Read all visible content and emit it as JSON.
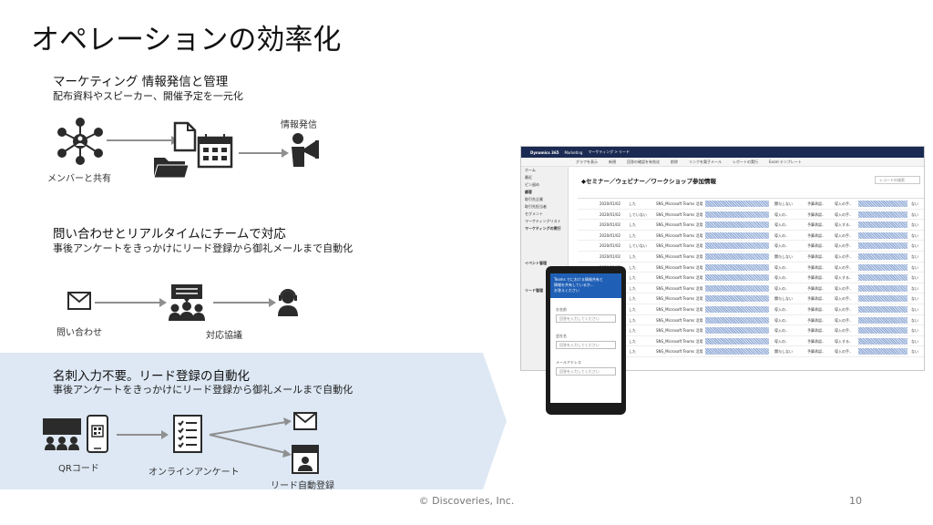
{
  "slide": {
    "title": "オペレーションの効率化",
    "footer": "© Discoveries, Inc.",
    "page_number": "10"
  },
  "sections": [
    {
      "heading": "マーケティング 情報発信と管理",
      "subheading": "配布資料やスピーカー、開催予定を一元化",
      "labels": {
        "share": "メンバーと共有",
        "publish": "情報発信"
      }
    },
    {
      "heading": "問い合わせとリアルタイムにチームで対応",
      "subheading": "事後アンケートをきっかけにリード登録から御礼メールまで自動化",
      "labels": {
        "inquiry": "問い合わせ",
        "response": "対応協議"
      }
    },
    {
      "heading": "名刺入力不要。リード登録の自動化",
      "subheading": "事後アンケートをきっかけにリード登録から御礼メールまで自動化",
      "labels": {
        "qr": "QRコード",
        "survey": "オンラインアンケート",
        "lead": "リード自動登録"
      }
    }
  ],
  "colors": {
    "band": "#dde8f4",
    "icon": "#2b2b2b",
    "arrow": "#8f8f8f",
    "crm_nav": "#1a2a52",
    "phone_header": "#1f5fb6"
  },
  "crm_screenshot": {
    "app_name": "Dynamics 365",
    "module": "Marketing",
    "breadcrumb": "マーケティング > リード",
    "commands": [
      "グラフを表示",
      "新規",
      "回答の確認を有効化",
      "削除",
      "リンクを電子メール",
      "レポートの実行",
      "Excel テンプレート"
    ],
    "view_title": "◆セミナー／ウェビナー／ワークショップ参加情報",
    "search_placeholder": "レコードの検索",
    "sidebar": [
      "ホーム",
      "最近",
      "ピン留め",
      "顧客",
      "取引先企業",
      "取引先担当者",
      "セグメント",
      "マーケティングリスト",
      "マーケティングの実行",
      "イベント管理",
      "リード管理"
    ],
    "rows": [
      {
        "date": "2020/01/02",
        "flag": "した",
        "source": "SNS_Microsoft Teams 活用",
        "status": "関与しない",
        "note": "予算承認..",
        "stage": "導入の手..",
        "yn": "ない"
      },
      {
        "date": "2020/01/02",
        "flag": "していない",
        "source": "SNS_Microsoft Teams 活用",
        "status": "導入の..",
        "note": "予算承認..",
        "stage": "導入の手..",
        "yn": "ない"
      },
      {
        "date": "2020/01/02",
        "flag": "した",
        "source": "SNS_Microsoft Teams 活用",
        "status": "導入の..",
        "note": "予算承認..",
        "stage": "導入する..",
        "yn": "ない"
      },
      {
        "date": "2020/01/02",
        "flag": "した",
        "source": "SNS_Microsoft Teams 活用",
        "status": "導入の..",
        "note": "予算承認..",
        "stage": "導入の手..",
        "yn": "ない"
      },
      {
        "date": "2020/01/02",
        "flag": "していない",
        "source": "SNS_Microsoft Teams 活用",
        "status": "導入の..",
        "note": "予算承認..",
        "stage": "導入の手..",
        "yn": "ない"
      },
      {
        "date": "2020/01/02",
        "flag": "した",
        "source": "SNS_Microsoft Teams 活用",
        "status": "関与しない",
        "note": "予算承認..",
        "stage": "導入の手..",
        "yn": "ない"
      },
      {
        "date": "2020/01/02",
        "flag": "した",
        "source": "SNS_Microsoft Teams 活用",
        "status": "導入の..",
        "note": "予算承認..",
        "stage": "導入の手..",
        "yn": "ない"
      },
      {
        "date": "2020/01/02",
        "flag": "した",
        "source": "SNS_Microsoft Teams 活用",
        "status": "導入の..",
        "note": "予算承認..",
        "stage": "導入する..",
        "yn": "ない"
      },
      {
        "date": "2020/01/02",
        "flag": "した",
        "source": "SNS_Microsoft Teams 活用",
        "status": "導入の..",
        "note": "予算承認..",
        "stage": "導入の手..",
        "yn": "ない"
      },
      {
        "date": "2020/01/02",
        "flag": "した",
        "source": "SNS_Microsoft Teams 活用",
        "status": "関与しない",
        "note": "予算承認..",
        "stage": "導入の手..",
        "yn": "ない"
      },
      {
        "date": "2020/01/02",
        "flag": "した",
        "source": "SNS_Microsoft Teams 活用",
        "status": "導入の..",
        "note": "予算承認..",
        "stage": "導入の手..",
        "yn": "ない"
      },
      {
        "date": "2020/01/02",
        "flag": "した",
        "source": "SNS_Microsoft Teams 活用",
        "status": "導入の..",
        "note": "予算承認..",
        "stage": "導入の手..",
        "yn": "ない"
      },
      {
        "date": "2020/01/02",
        "flag": "した",
        "source": "SNS_Microsoft Teams 活用",
        "status": "導入の..",
        "note": "予算承認..",
        "stage": "導入の手..",
        "yn": "ない"
      },
      {
        "date": "2020/01/02",
        "flag": "した",
        "source": "SNS_Microsoft Teams 活用",
        "status": "導入の..",
        "note": "予算承認..",
        "stage": "導入する..",
        "yn": "ない"
      },
      {
        "date": "2020/01/02",
        "flag": "した",
        "source": "SNS_Microsoft Teams 活用",
        "status": "関与しない",
        "note": "予算承認..",
        "stage": "導入の手..",
        "yn": "ない"
      }
    ]
  },
  "phone_screenshot": {
    "header_lines": [
      "Teams でにおける情報共有と",
      "情報を共有しているか...",
      "お答えください"
    ],
    "fields": [
      {
        "label": "お名前",
        "placeholder": "回答を入力してください"
      },
      {
        "label": "会社名",
        "placeholder": "回答を入力してください"
      },
      {
        "label": "メールアドレス",
        "placeholder": "回答を入力してください"
      }
    ]
  }
}
